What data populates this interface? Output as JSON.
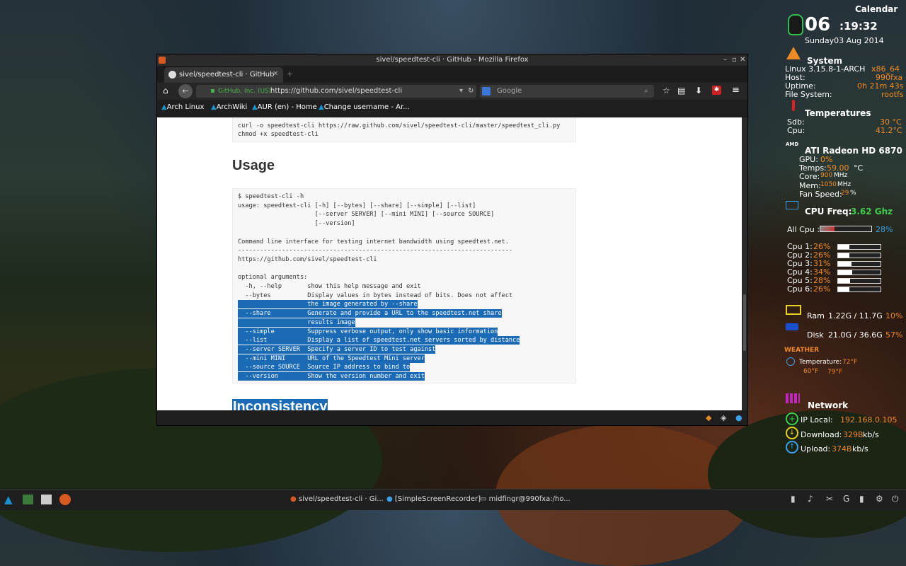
{
  "desktop": {
    "conky": {
      "calendar_label": "Calendar",
      "time_hour": "06",
      "time_rest": ":19:32",
      "date": "Sunday03 Aug 2014",
      "system": {
        "header": "System",
        "os": "Linux 3.15.8-1-ARCH",
        "arch": "x86_64",
        "host_label": "Host:",
        "host": "990fxa",
        "uptime_label": "Uptime:",
        "uptime": "0h 21m 43s",
        "fs_label": "File System:",
        "fs": "rootfs"
      },
      "temperatures": {
        "header": "Temperatures",
        "sdb_label": "Sdb:",
        "sdb": "30 °C",
        "cpu_label": "Cpu:",
        "cpu": "41.2°C"
      },
      "gpu": {
        "amd_label": "AMD",
        "header": "ATI Radeon HD 6870",
        "gpu_label": "GPU:",
        "gpu_value": "0%",
        "temps_label": "Temps:",
        "temps_value": "59.00",
        "temps_unit": "°C",
        "core_label": "Core:",
        "core_value": "900",
        "core_unit": "MHz",
        "mem_label": "Mem:",
        "mem_value": "1050",
        "mem_unit": "MHz",
        "fan_label": "Fan Speed:",
        "fan_value": "29",
        "fan_unit": "%"
      },
      "cpu": {
        "freq_label": "CPU Freq:",
        "freq_value": "3.62 Ghz",
        "all_label": "All Cpu :",
        "all_value": "28%",
        "all_fraction": 0.28,
        "cores": [
          {
            "label": "Cpu 1:",
            "value": "26%",
            "fraction": 0.26
          },
          {
            "label": "Cpu 2:",
            "value": "26%",
            "fraction": 0.26
          },
          {
            "label": "Cpu 3:",
            "value": "31%",
            "fraction": 0.31
          },
          {
            "label": "Cpu 4:",
            "value": "34%",
            "fraction": 0.34
          },
          {
            "label": "Cpu 5:",
            "value": "28%",
            "fraction": 0.28
          },
          {
            "label": "Cpu 6:",
            "value": "26%",
            "fraction": 0.26
          }
        ]
      },
      "ram": {
        "label": "Ram",
        "value": "1.22G / 11.7G",
        "percent": "10%"
      },
      "disk": {
        "label": "Disk",
        "value": "21.0G / 36.6G",
        "percent": "57%"
      },
      "weather": {
        "header": "WEATHER",
        "temp_label": "Temperature:",
        "temp_value": "72°F",
        "low": "60°F",
        "high": "79°F"
      },
      "network": {
        "header": "Network",
        "ip_label": "IP Local:",
        "ip": "192.168.0.105",
        "down_label": "Download:",
        "down_value": "329B",
        "down_unit": "kb/s",
        "up_label": "Upload:",
        "up_value": "374B",
        "up_unit": "kb/s"
      }
    }
  },
  "browser": {
    "window_title": "sivel/speedtest-cli · GitHub - Mozilla Firefox",
    "tab_title": "sivel/speedtest-cli · GitHub",
    "identity": "GitHub, Inc. (US)",
    "url": "https://github.com/sivel/speedtest-cli",
    "search_placeholder": "Google",
    "bookmarks": [
      "Arch Linux",
      "ArchWiki",
      "AUR (en) - Home",
      "Change username - Ar..."
    ],
    "page": {
      "install_lines": [
        "curl -o speedtest-cli https://raw.github.com/sivel/speedtest-cli/master/speedtest_cli.py",
        "chmod +x speedtest-cli"
      ],
      "usage_heading": "Usage",
      "usage_lines": [
        {
          "text": "$ speedtest-cli -h",
          "selected": false
        },
        {
          "text": "usage: speedtest-cli [-h] [--bytes] [--share] [--simple] [--list]",
          "selected": false
        },
        {
          "text": "                     [--server SERVER] [--mini MINI] [--source SOURCE]",
          "selected": false
        },
        {
          "text": "                     [--version]",
          "selected": false
        },
        {
          "text": "",
          "selected": false
        },
        {
          "text": "Command line interface for testing internet bandwidth using speedtest.net.",
          "selected": false
        },
        {
          "text": "---------------------------------------------------------------------------",
          "selected": false
        },
        {
          "text": "https://github.com/sivel/speedtest-cli",
          "selected": false
        },
        {
          "text": "",
          "selected": false
        },
        {
          "text": "optional arguments:",
          "selected": false
        },
        {
          "text": "  -h, --help       show this help message and exit",
          "selected": false
        },
        {
          "text": "  --bytes          Display values in bytes instead of bits. Does not affect",
          "selected": false
        },
        {
          "text": "                   the image generated by --share",
          "selected": true
        },
        {
          "text": "  --share          Generate and provide a URL to the speedtest.net share",
          "selected": true
        },
        {
          "text": "                   results image",
          "selected": true
        },
        {
          "text": "  --simple         Suppress verbose output, only show basic information",
          "selected": true
        },
        {
          "text": "  --list           Display a list of speedtest.net servers sorted by distance",
          "selected": true
        },
        {
          "text": "  --server SERVER  Specify a server ID to test against",
          "selected": true
        },
        {
          "text": "  --mini MINI      URL of the Speedtest Mini server",
          "selected": true
        },
        {
          "text": "  --source SOURCE  Source IP address to bind to",
          "selected": true
        },
        {
          "text": "  --version        Show the version number and exit",
          "selected": true
        }
      ],
      "next_heading": "Inconsistency"
    }
  },
  "taskbar": {
    "tasks": [
      "sivel/speedtest-cli · Gi...",
      "[SimpleScreenRecorder]",
      "midfingr@990fxa:/ho..."
    ]
  }
}
